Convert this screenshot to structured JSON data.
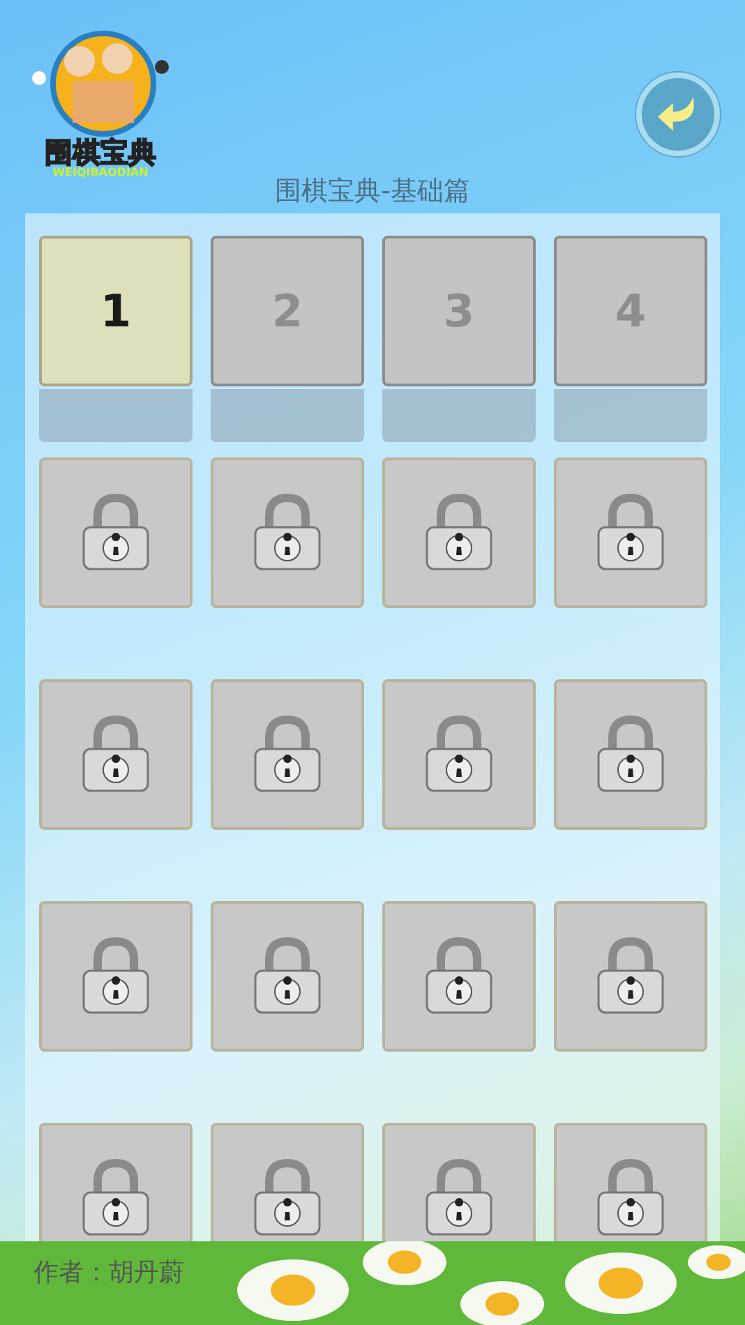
{
  "logo": {
    "title": "围棋宝典",
    "subtitle": "WEIQIBAODIAN"
  },
  "title": "围棋宝典-基础篇",
  "levels": [
    {
      "kind": "unlocked",
      "label": "1",
      "selected": true
    },
    {
      "kind": "unlocked",
      "label": "2",
      "selected": false
    },
    {
      "kind": "unlocked",
      "label": "3",
      "selected": false
    },
    {
      "kind": "unlocked",
      "label": "4",
      "selected": false
    },
    {
      "kind": "locked"
    },
    {
      "kind": "locked"
    },
    {
      "kind": "locked"
    },
    {
      "kind": "locked"
    },
    {
      "kind": "locked"
    },
    {
      "kind": "locked"
    },
    {
      "kind": "locked"
    },
    {
      "kind": "locked"
    },
    {
      "kind": "locked"
    },
    {
      "kind": "locked"
    },
    {
      "kind": "locked"
    },
    {
      "kind": "locked"
    },
    {
      "kind": "locked"
    },
    {
      "kind": "locked"
    },
    {
      "kind": "locked"
    },
    {
      "kind": "locked"
    }
  ],
  "author": "作者：胡丹蔚"
}
